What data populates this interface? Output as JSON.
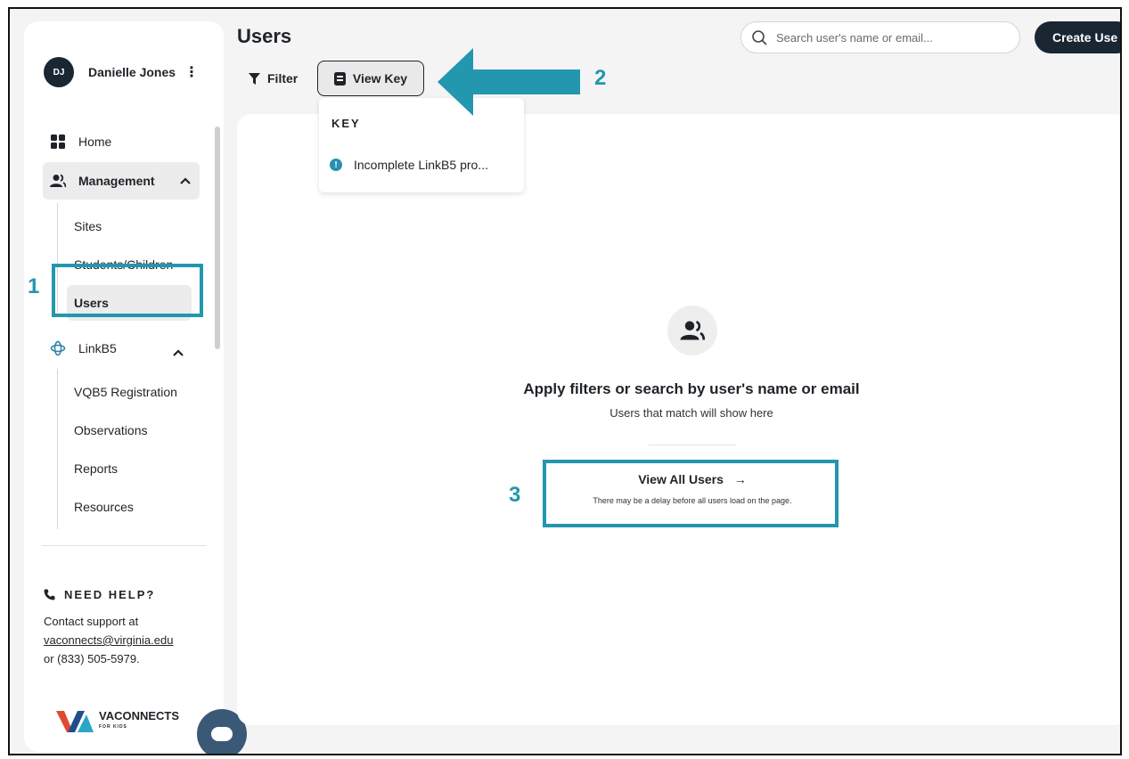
{
  "user": {
    "initials": "DJ",
    "name": "Danielle Jones",
    "menu_glyph": "⋮"
  },
  "sidebar": {
    "home_label": "Home",
    "management_label": "Management",
    "management_items": [
      "Sites",
      "Students/Children",
      "Users"
    ],
    "linkb5_label": "LinkB5",
    "linkb5_items": [
      "VQB5 Registration",
      "Observations",
      "Reports",
      "Resources"
    ]
  },
  "help": {
    "title": "NEED HELP?",
    "line1": "Contact support at",
    "email": "vaconnects@virginia.edu",
    "line3": "or (833) 505-5979."
  },
  "logo": {
    "name": "VACONNECTS",
    "tagline": "FOR KIDS"
  },
  "header": {
    "page_title": "Users",
    "filter_label": "Filter",
    "view_key_label": "View Key",
    "search_placeholder": "Search user's name or email...",
    "create_label": "Create Use"
  },
  "key_popup": {
    "title": "KEY",
    "item": "Incomplete LinkB5 pro..."
  },
  "empty_state": {
    "title": "Apply filters or search by user's name or email",
    "subtitle": "Users that match will show here",
    "view_all_label": "View All Users",
    "view_all_arrow": "→",
    "delay_note": "There may be a delay before all users load on the page."
  },
  "annotations": {
    "step1": "1",
    "step2": "2",
    "step3": "3"
  },
  "colors": {
    "annotation": "#2297ad",
    "dark": "#1b2633",
    "chat": "#3a5977"
  }
}
